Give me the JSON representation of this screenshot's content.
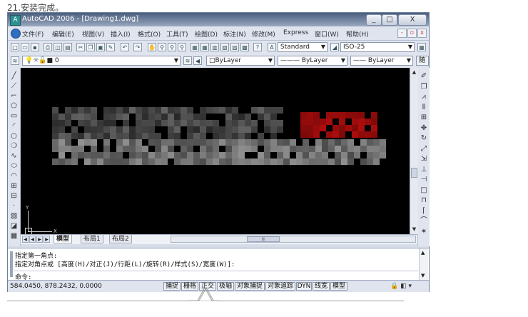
{
  "caption": "21.安装完成。",
  "window": {
    "title": "AutoCAD 2006 - [Drawing1.dwg]",
    "controls": {
      "minimize": "_",
      "maximize": "□",
      "close": "X"
    }
  },
  "menu": {
    "items": [
      "文件(F)",
      "编辑(E)",
      "视图(V)",
      "插入(I)",
      "格式(O)",
      "工具(T)",
      "绘图(D)",
      "标注(N)",
      "修改(M)",
      "Express",
      "窗口(W)",
      "帮助(H)"
    ],
    "doc_controls": {
      "minimize": "-",
      "restore": "▫",
      "close": "x"
    }
  },
  "toolbar_standard": {
    "text_style": "Standard",
    "dim_style": "ISO-25"
  },
  "toolbar_layers": {
    "layer": "0",
    "color": "□ByLayer",
    "linetype": "——— ByLayer",
    "lineweight": "—— ByLayer",
    "plot_style": "随颜色"
  },
  "icons": {
    "left": [
      "line-icon",
      "construction-line-icon",
      "polyline-icon",
      "polygon-icon",
      "rectangle-icon",
      "arc-icon",
      "circle-icon",
      "revision-cloud-icon",
      "spline-icon",
      "ellipse-icon",
      "ellipse-arc-icon",
      "insert-block-icon",
      "make-block-icon",
      "point-icon",
      "hatch-icon",
      "region-icon",
      "table-icon"
    ],
    "right": [
      "erase-icon",
      "copy-icon",
      "mirror-icon",
      "offset-icon",
      "array-icon",
      "move-icon",
      "rotate-icon",
      "scale-icon",
      "stretch-icon",
      "trim-icon",
      "extend-icon",
      "break-icon",
      "join-icon",
      "chamfer-icon",
      "fillet-icon",
      "explode-icon"
    ]
  },
  "ucs": {
    "x_label": "X",
    "y_label": "Y"
  },
  "layout_tabs": [
    "模型",
    "布局1",
    "布局2"
  ],
  "hscroll_label": "Ⅲ",
  "command": {
    "lines": [
      "指定第一角点:",
      "指定对角点或 [高度(H)/对正(J)/行距(L)/旋转(R)/样式(S)/宽度(W)]:"
    ],
    "prompt": "命令:"
  },
  "status": {
    "coordinates": "584.0450,  878.2432,  0.0000",
    "buttons": [
      "捕捉",
      "栅格",
      "正交",
      "极轴",
      "对象捕捉",
      "对象追踪",
      "DYN",
      "线宽",
      "模型"
    ]
  },
  "colors": {
    "canvas": "#000000",
    "titlebar": "#4a5f7f",
    "accent_red": "#8b1010"
  }
}
